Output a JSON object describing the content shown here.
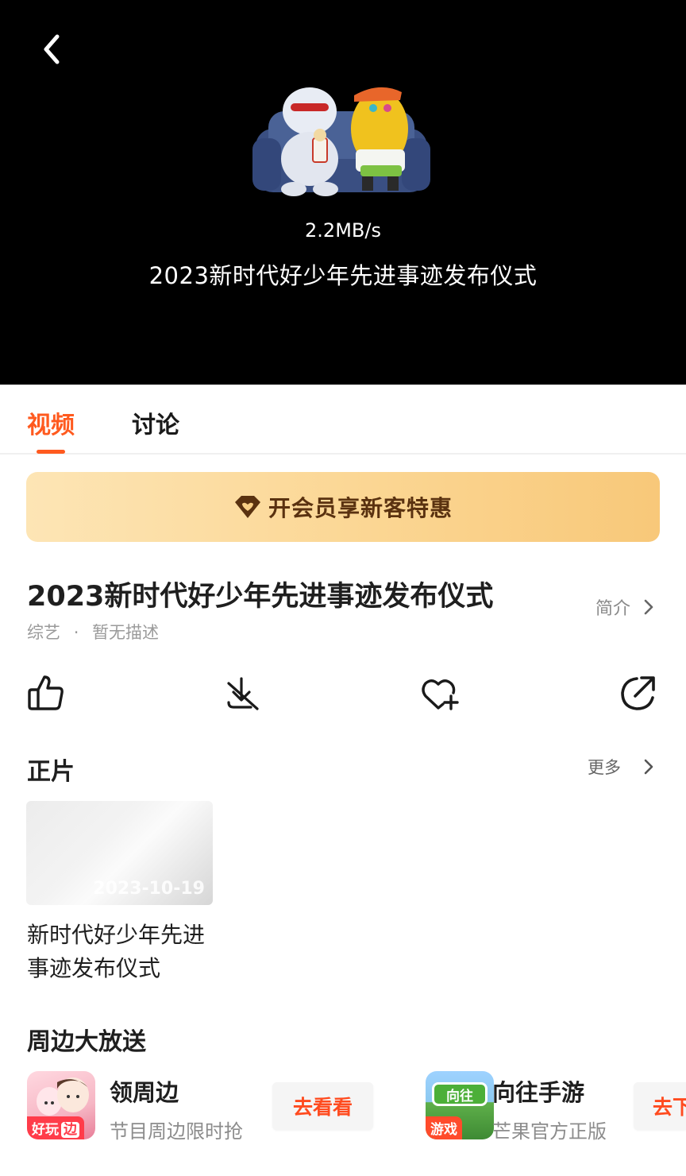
{
  "player": {
    "speed": "2.2MB/s",
    "title": "2023新时代好少年先进事迹发布仪式"
  },
  "tabs": [
    {
      "label": "视频",
      "active": true
    },
    {
      "label": "讨论",
      "active": false
    }
  ],
  "vip_banner": {
    "label": "开会员享新客特惠",
    "icon": "diamond-heart-icon"
  },
  "show": {
    "title": "2023新时代好少年先进事迹发布仪式",
    "intro_label": "简介",
    "category": "综艺",
    "separator": "·",
    "description": "暂无描述"
  },
  "actions": [
    {
      "name": "like",
      "icon": "thumb-up-icon"
    },
    {
      "name": "download-disabled",
      "icon": "download-off-icon"
    },
    {
      "name": "favorite",
      "icon": "heart-plus-icon"
    },
    {
      "name": "share",
      "icon": "share-arrow-icon"
    }
  ],
  "episodes": {
    "section_title": "正片",
    "more_label": "更多",
    "items": [
      {
        "date": "2023-10-19",
        "title": "新时代好少年先进事迹发布仪式"
      }
    ]
  },
  "promos": {
    "section_title": "周边大放送",
    "items": [
      {
        "name": "领周边",
        "subtitle": "节目周边限时抢",
        "button": "去看看",
        "badge": "好玩",
        "badge_extra": "边"
      },
      {
        "name": "向往手游",
        "subtitle": "芒果官方正版",
        "button": "去下",
        "badge": "游戏",
        "icon_text": "向往"
      }
    ]
  },
  "colors": {
    "accent": "#ff5a1f",
    "vip_text": "#5a3210",
    "player_bg": "#000000"
  }
}
